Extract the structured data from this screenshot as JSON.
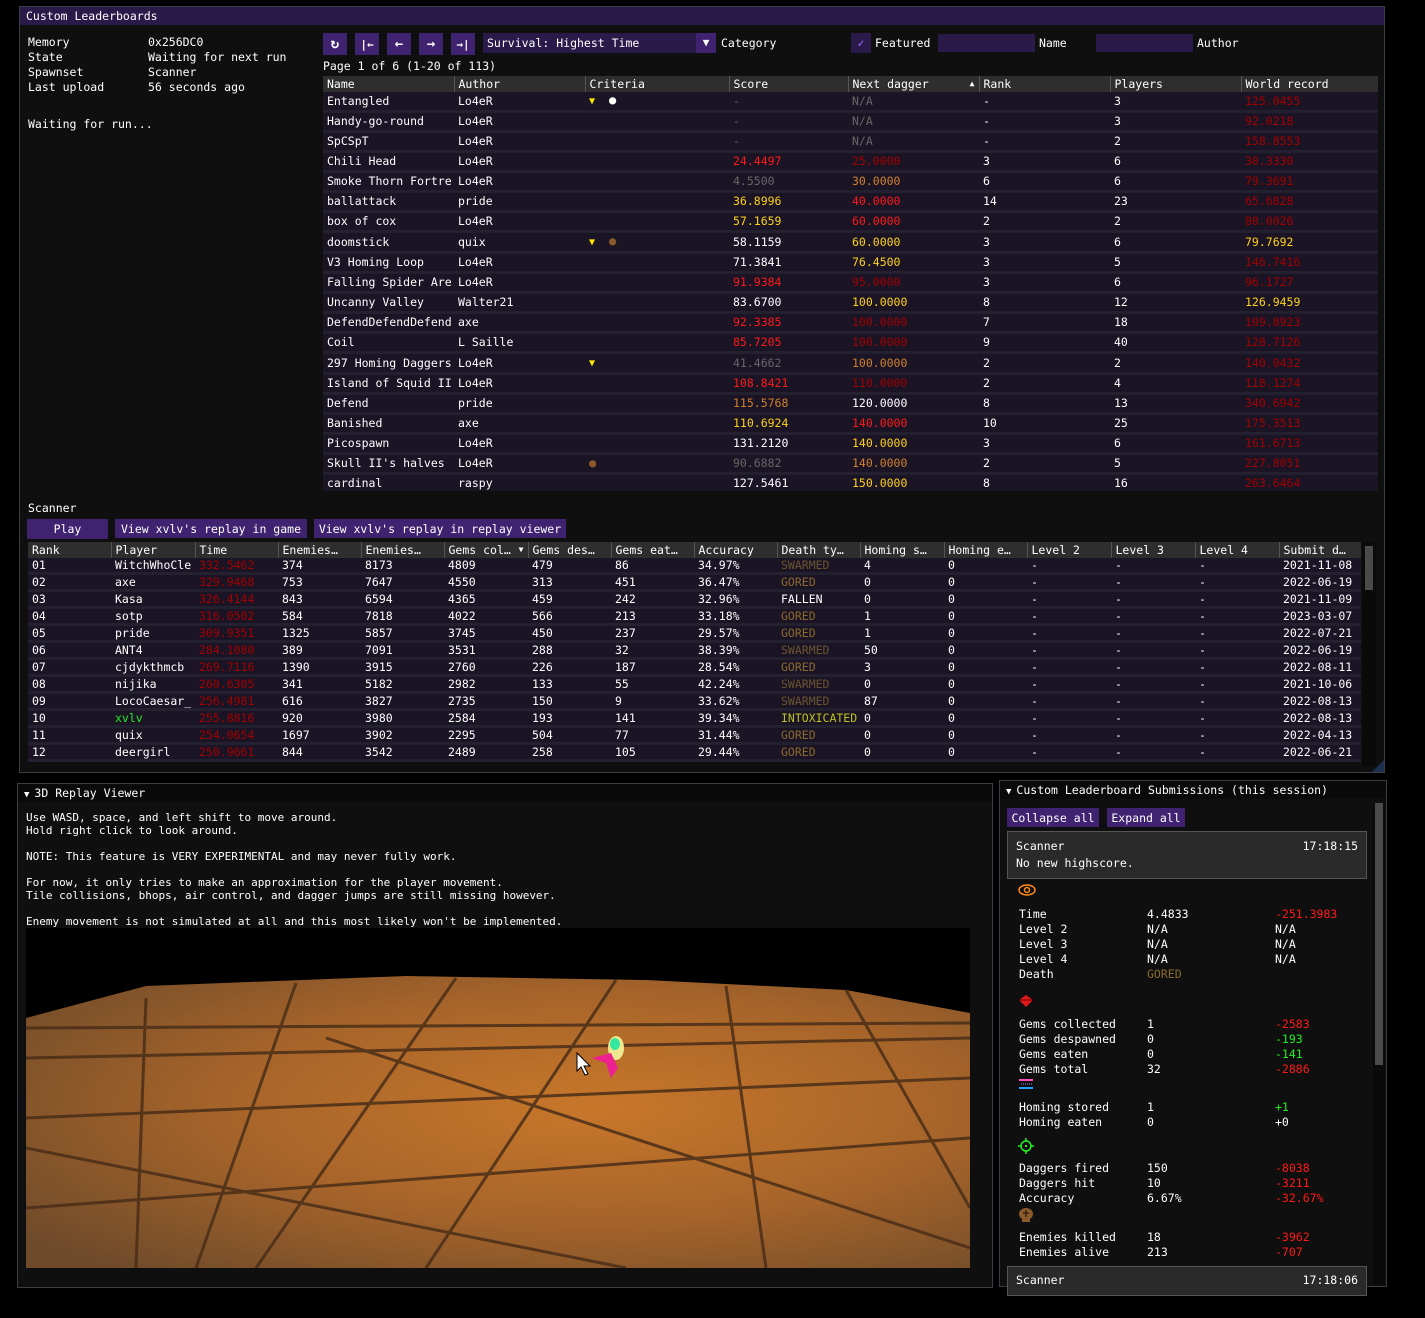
{
  "leaderboards_window": {
    "title": "Custom Leaderboards",
    "info": [
      {
        "key": "Memory",
        "value": "0x256DC0"
      },
      {
        "key": "State",
        "value": "Waiting for next run"
      },
      {
        "key": "Spawnset",
        "value": "Scanner"
      },
      {
        "key": "Last upload",
        "value": "56 seconds ago"
      }
    ],
    "waiting_text": "Waiting for run...",
    "toolbar": {
      "refresh_icon": "↻",
      "first_icon": "|←",
      "prev_icon": "←",
      "next_icon": "→",
      "last_icon": "→|",
      "category_value": "Survival: Highest Time",
      "category_label": "Category",
      "featured_label": "Featured",
      "featured_checked": true,
      "name_value": "",
      "name_label": "Name",
      "author_value": "",
      "author_label": "Author"
    },
    "page_info": "Page 1 of 6 (1-20 of 113)",
    "columns": [
      "Name",
      "Author",
      "Criteria",
      "Score",
      "Next dagger",
      "Rank",
      "Players",
      "World record"
    ],
    "sort_indicator": "▲",
    "rows": [
      {
        "name": "Entangled",
        "author": "Lo4eR",
        "criteria": [
          "dagger-icon",
          "skull-white-icon"
        ],
        "score": "-",
        "score_color": "dim",
        "next": "N/A",
        "next_color": "dim",
        "rank": "-",
        "players": "3",
        "wr": "125.0455",
        "wr_color": "dred"
      },
      {
        "name": "Handy-go-round",
        "author": "Lo4eR",
        "criteria": [],
        "score": "-",
        "score_color": "dim",
        "next": "N/A",
        "next_color": "dim",
        "rank": "-",
        "players": "3",
        "wr": "92.0218",
        "wr_color": "dred"
      },
      {
        "name": "SpCSpT",
        "author": "Lo4eR",
        "criteria": [],
        "score": "-",
        "score_color": "dim",
        "next": "N/A",
        "next_color": "dim",
        "rank": "-",
        "players": "2",
        "wr": "158.8553",
        "wr_color": "dred"
      },
      {
        "name": "Chili Head",
        "author": "Lo4eR",
        "criteria": [],
        "score": "24.4497",
        "score_color": "red",
        "next": "25.0000",
        "next_color": "dred",
        "rank": "3",
        "players": "6",
        "wr": "30.3330",
        "wr_color": "dred"
      },
      {
        "name": "Smoke Thorn Fortre",
        "author": "Lo4eR",
        "criteria": [],
        "score": "4.5500",
        "score_color": "dim",
        "next": "30.0000",
        "next_color": "ora",
        "rank": "6",
        "players": "6",
        "wr": "79.3691",
        "wr_color": "dred"
      },
      {
        "name": "ballattack",
        "author": "pride",
        "criteria": [],
        "score": "36.8996",
        "score_color": "yel",
        "next": "40.0000",
        "next_color": "red",
        "rank": "14",
        "players": "23",
        "wr": "65.6828",
        "wr_color": "dred"
      },
      {
        "name": "box of cox",
        "author": "Lo4eR",
        "criteria": [],
        "score": "57.1659",
        "score_color": "yel",
        "next": "60.0000",
        "next_color": "red",
        "rank": "2",
        "players": "2",
        "wr": "80.0026",
        "wr_color": "dred"
      },
      {
        "name": "doomstick",
        "author": "quix",
        "criteria": [
          "dagger-icon",
          "skull-brown-icon"
        ],
        "score": "58.1159",
        "score_color": "",
        "next": "60.0000",
        "next_color": "yel",
        "rank": "3",
        "players": "6",
        "wr": "79.7692",
        "wr_color": "yel"
      },
      {
        "name": "V3 Homing Loop",
        "author": "Lo4eR",
        "criteria": [],
        "score": "71.3841",
        "score_color": "",
        "next": "76.4500",
        "next_color": "yel",
        "rank": "3",
        "players": "5",
        "wr": "146.7416",
        "wr_color": "dred"
      },
      {
        "name": "Falling Spider Are",
        "author": "Lo4eR",
        "criteria": [],
        "score": "91.9384",
        "score_color": "red",
        "next": "95.0000",
        "next_color": "dred",
        "rank": "3",
        "players": "6",
        "wr": "96.1727",
        "wr_color": "dred"
      },
      {
        "name": "Uncanny Valley",
        "author": "Walter21",
        "criteria": [],
        "score": "83.6700",
        "score_color": "",
        "next": "100.0000",
        "next_color": "yel",
        "rank": "8",
        "players": "12",
        "wr": "126.9459",
        "wr_color": "yel"
      },
      {
        "name": "DefendDefendDefend",
        "author": "axe",
        "criteria": [],
        "score": "92.3385",
        "score_color": "red",
        "next": "100.0000",
        "next_color": "dred",
        "rank": "7",
        "players": "18",
        "wr": "109.8923",
        "wr_color": "dred"
      },
      {
        "name": "Coil",
        "author": "L Saille",
        "criteria": [],
        "score": "85.7205",
        "score_color": "red",
        "next": "100.0000",
        "next_color": "dred",
        "rank": "9",
        "players": "40",
        "wr": "128.7126",
        "wr_color": "dred"
      },
      {
        "name": "297 Homing Daggers",
        "author": "Lo4eR",
        "criteria": [
          "dagger-icon"
        ],
        "score": "41.4662",
        "score_color": "dim",
        "next": "100.0000",
        "next_color": "ora",
        "rank": "2",
        "players": "2",
        "wr": "140.0432",
        "wr_color": "dred"
      },
      {
        "name": "Island of Squid II",
        "author": "Lo4eR",
        "criteria": [],
        "score": "108.8421",
        "score_color": "red",
        "next": "110.0000",
        "next_color": "dred",
        "rank": "2",
        "players": "4",
        "wr": "118.1274",
        "wr_color": "dred"
      },
      {
        "name": "Defend",
        "author": "pride",
        "criteria": [],
        "score": "115.5768",
        "score_color": "ora",
        "next": "120.0000",
        "next_color": "",
        "rank": "8",
        "players": "13",
        "wr": "340.6942",
        "wr_color": "dred"
      },
      {
        "name": "Banished",
        "author": "axe",
        "criteria": [],
        "score": "110.6924",
        "score_color": "yel",
        "next": "140.0000",
        "next_color": "red",
        "rank": "10",
        "players": "25",
        "wr": "175.3513",
        "wr_color": "dred"
      },
      {
        "name": "Picospawn",
        "author": "Lo4eR",
        "criteria": [],
        "score": "131.2120",
        "score_color": "",
        "next": "140.0000",
        "next_color": "yel",
        "rank": "3",
        "players": "6",
        "wr": "161.6713",
        "wr_color": "dred"
      },
      {
        "name": "Skull II's halves",
        "author": "Lo4eR",
        "criteria": [
          "skull-brown-icon"
        ],
        "score": "90.6882",
        "score_color": "dim",
        "next": "140.0000",
        "next_color": "ora",
        "rank": "2",
        "players": "5",
        "wr": "227.8051",
        "wr_color": "dred"
      },
      {
        "name": "cardinal",
        "author": "raspy",
        "criteria": [],
        "score": "127.5461",
        "score_color": "",
        "next": "150.0000",
        "next_color": "yel",
        "rank": "8",
        "players": "16",
        "wr": "263.6464",
        "wr_color": "dred"
      }
    ]
  },
  "scanner": {
    "title": "Scanner",
    "play_label": "Play",
    "view_in_game_label": "View xvlv's replay in game",
    "view_in_viewer_label": "View xvlv's replay in replay viewer",
    "columns": [
      "Rank",
      "Player",
      "Time",
      "Enemies…",
      "Enemies…",
      "Gems col…",
      "Gems des…",
      "Gems eat…",
      "Accuracy",
      "Death ty…",
      "Homing s…",
      "Homing e…",
      "Level 2",
      "Level 3",
      "Level 4",
      "Submit d…"
    ],
    "sort_indicator": "▼",
    "rows": [
      {
        "rank": "01",
        "player": "WitchWhoCle",
        "player_color": "",
        "time": "332.5462",
        "ek": "374",
        "ea": "8173",
        "gc": "4809",
        "gd": "479",
        "ge": "86",
        "acc": "34.97%",
        "death": "SWARMED",
        "death_color": "swm",
        "hs": "4",
        "he": "0",
        "l2": "-",
        "l3": "-",
        "l4": "-",
        "date": "2021-11-08"
      },
      {
        "rank": "02",
        "player": "axe",
        "player_color": "",
        "time": "329.9468",
        "ek": "753",
        "ea": "7647",
        "gc": "4550",
        "gd": "313",
        "ge": "451",
        "acc": "36.47%",
        "death": "GORED",
        "death_color": "brn",
        "hs": "0",
        "he": "0",
        "l2": "-",
        "l3": "-",
        "l4": "-",
        "date": "2022-06-19"
      },
      {
        "rank": "03",
        "player": "Kasa",
        "player_color": "",
        "time": "326.4144",
        "ek": "843",
        "ea": "6594",
        "gc": "4365",
        "gd": "459",
        "ge": "242",
        "acc": "32.96%",
        "death": "FALLEN",
        "death_color": "",
        "hs": "0",
        "he": "0",
        "l2": "-",
        "l3": "-",
        "l4": "-",
        "date": "2021-11-09"
      },
      {
        "rank": "04",
        "player": "sotp",
        "player_color": "",
        "time": "316.0502",
        "ek": "584",
        "ea": "7818",
        "gc": "4022",
        "gd": "566",
        "ge": "213",
        "acc": "33.18%",
        "death": "GORED",
        "death_color": "brn",
        "hs": "1",
        "he": "0",
        "l2": "-",
        "l3": "-",
        "l4": "-",
        "date": "2023-03-07"
      },
      {
        "rank": "05",
        "player": "pride",
        "player_color": "",
        "time": "309.9351",
        "ek": "1325",
        "ea": "5857",
        "gc": "3745",
        "gd": "450",
        "ge": "237",
        "acc": "29.57%",
        "death": "GORED",
        "death_color": "brn",
        "hs": "1",
        "he": "0",
        "l2": "-",
        "l3": "-",
        "l4": "-",
        "date": "2022-07-21"
      },
      {
        "rank": "06",
        "player": "ANT4",
        "player_color": "",
        "time": "284.1080",
        "ek": "389",
        "ea": "7091",
        "gc": "3531",
        "gd": "288",
        "ge": "32",
        "acc": "38.39%",
        "death": "SWARMED",
        "death_color": "swm",
        "hs": "50",
        "he": "0",
        "l2": "-",
        "l3": "-",
        "l4": "-",
        "date": "2022-06-19"
      },
      {
        "rank": "07",
        "player": "cjdykthmcb",
        "player_color": "",
        "time": "269.7116",
        "ek": "1390",
        "ea": "3915",
        "gc": "2760",
        "gd": "226",
        "ge": "187",
        "acc": "28.54%",
        "death": "GORED",
        "death_color": "brn",
        "hs": "3",
        "he": "0",
        "l2": "-",
        "l3": "-",
        "l4": "-",
        "date": "2022-08-11"
      },
      {
        "rank": "08",
        "player": "nijika",
        "player_color": "",
        "time": "260.6305",
        "ek": "341",
        "ea": "5182",
        "gc": "2982",
        "gd": "133",
        "ge": "55",
        "acc": "42.24%",
        "death": "SWARMED",
        "death_color": "swm",
        "hs": "0",
        "he": "0",
        "l2": "-",
        "l3": "-",
        "l4": "-",
        "date": "2021-10-06"
      },
      {
        "rank": "09",
        "player": "LocoCaesar_",
        "player_color": "",
        "time": "256.4981",
        "ek": "616",
        "ea": "3827",
        "gc": "2735",
        "gd": "150",
        "ge": "9",
        "acc": "33.62%",
        "death": "SWARMED",
        "death_color": "swm",
        "hs": "87",
        "he": "0",
        "l2": "-",
        "l3": "-",
        "l4": "-",
        "date": "2022-08-13"
      },
      {
        "rank": "10",
        "player": "xvlv",
        "player_color": "grn",
        "time": "255.8816",
        "ek": "920",
        "ea": "3980",
        "gc": "2584",
        "gd": "193",
        "ge": "141",
        "acc": "39.34%",
        "death": "INTOXICATED",
        "death_color": "tox",
        "hs": "0",
        "he": "0",
        "l2": "-",
        "l3": "-",
        "l4": "-",
        "date": "2022-08-13"
      },
      {
        "rank": "11",
        "player": "quix",
        "player_color": "",
        "time": "254.0654",
        "ek": "1697",
        "ea": "3902",
        "gc": "2295",
        "gd": "504",
        "ge": "77",
        "acc": "31.44%",
        "death": "GORED",
        "death_color": "brn",
        "hs": "0",
        "he": "0",
        "l2": "-",
        "l3": "-",
        "l4": "-",
        "date": "2022-04-13"
      },
      {
        "rank": "12",
        "player": "deergirl",
        "player_color": "",
        "time": "250.9661",
        "ek": "844",
        "ea": "3542",
        "gc": "2489",
        "gd": "258",
        "ge": "105",
        "acc": "29.44%",
        "death": "GORED",
        "death_color": "brn",
        "hs": "0",
        "he": "0",
        "l2": "-",
        "l3": "-",
        "l4": "-",
        "date": "2022-06-21"
      }
    ]
  },
  "replay_viewer": {
    "title": "3D Replay Viewer",
    "lines": [
      "Use WASD, space, and left shift to move around.",
      "Hold right click to look around.",
      "",
      "NOTE: This feature is VERY EXPERIMENTAL and may never fully work.",
      "",
      "For now, it only tries to make an approximation for the player movement.",
      "Tile collisions, bhops, air control, and dagger jumps are still missing however.",
      "",
      "Enemy movement is not simulated at all and this most likely won't be implemented."
    ]
  },
  "submissions": {
    "title": "Custom Leaderboard Submissions (this session)",
    "collapse_label": "Collapse all",
    "expand_label": "Expand all",
    "entries": [
      {
        "spawnset": "Scanner",
        "time": "17:18:15",
        "message": "No new highscore."
      },
      {
        "spawnset": "Scanner",
        "time": "17:18:06"
      }
    ],
    "groups": [
      {
        "icon": "eye-icon",
        "rows": [
          {
            "label": "Time",
            "value": "4.4833",
            "diff": "-251.3983",
            "diff_color": "red"
          },
          {
            "label": "Level 2",
            "value": "N/A",
            "diff": "N/A",
            "diff_color": ""
          },
          {
            "label": "Level 3",
            "value": "N/A",
            "diff": "N/A",
            "diff_color": ""
          },
          {
            "label": "Level 4",
            "value": "N/A",
            "diff": "N/A",
            "diff_color": ""
          },
          {
            "label": "Death",
            "value": "GORED",
            "value_color": "brn",
            "diff": "",
            "diff_color": ""
          }
        ]
      },
      {
        "icon": "gem-icon",
        "rows": [
          {
            "label": "Gems collected",
            "value": "1",
            "diff": "-2583",
            "diff_color": "red"
          },
          {
            "label": "Gems despawned",
            "value": "0",
            "diff": "-193",
            "diff_color": "grn"
          },
          {
            "label": "Gems eaten",
            "value": "0",
            "diff": "-141",
            "diff_color": "grn"
          },
          {
            "label": "Gems total",
            "value": "32",
            "diff": "-2886",
            "diff_color": "red"
          }
        ]
      },
      {
        "icon": "homing-daggers-icon",
        "rows": [
          {
            "label": "Homing stored",
            "value": "1",
            "diff": "+1",
            "diff_color": "grn"
          },
          {
            "label": "Homing eaten",
            "value": "0",
            "diff": "+0",
            "diff_color": ""
          }
        ]
      },
      {
        "icon": "crosshair-icon",
        "rows": [
          {
            "label": "Daggers fired",
            "value": "150",
            "diff": "-8038",
            "diff_color": "red"
          },
          {
            "label": "Daggers hit",
            "value": "10",
            "diff": "-3211",
            "diff_color": "red"
          },
          {
            "label": "Accuracy",
            "value": "6.67%",
            "diff": "-32.67%",
            "diff_color": "red"
          }
        ]
      },
      {
        "icon": "skull-icon",
        "rows": [
          {
            "label": "Enemies killed",
            "value": "18",
            "diff": "-3962",
            "diff_color": "red"
          },
          {
            "label": "Enemies alive",
            "value": "213",
            "diff": "-707",
            "diff_color": "red"
          }
        ]
      }
    ]
  },
  "colors": {
    "accent": "#3f2370",
    "title_active": "#2a1a4a",
    "row_bg": "#1a1424",
    "red": "#ff1a1a",
    "dark_red": "#a30000",
    "yellow": "#ffd21a",
    "orange": "#d08030",
    "green": "#22ee22"
  }
}
